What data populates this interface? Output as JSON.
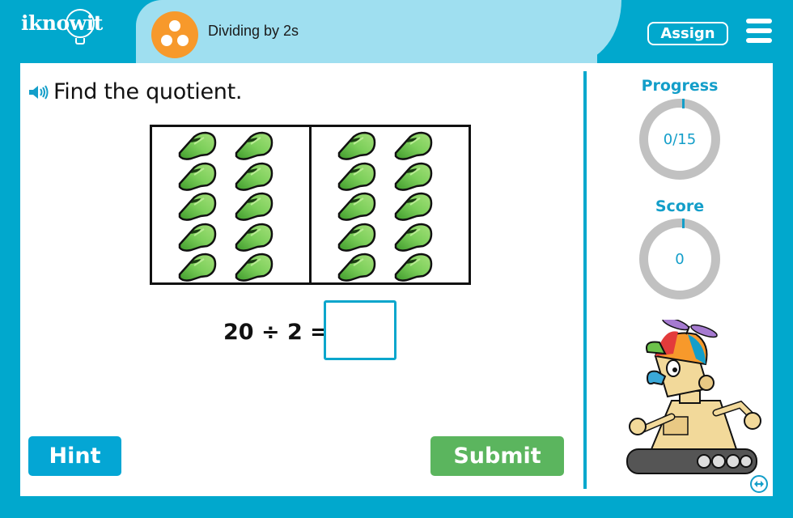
{
  "header": {
    "logo_text": "iknowit",
    "topic_icon": "three-dots-icon",
    "topic_title": "Dividing by 2s",
    "assign_label": "Assign",
    "menu_icon": "hamburger-menu-icon"
  },
  "question": {
    "speaker_icon": "speaker-icon",
    "prompt": "Find the quotient.",
    "groups": [
      {
        "item": "whistle",
        "count": 10
      },
      {
        "item": "whistle",
        "count": 10
      }
    ],
    "equation": "20 ÷ 2 =",
    "answer_value": "",
    "answer_placeholder": ""
  },
  "buttons": {
    "hint_label": "Hint",
    "submit_label": "Submit"
  },
  "sidebar": {
    "progress_label": "Progress",
    "progress_value": "0/15",
    "progress_fraction": 0,
    "score_label": "Score",
    "score_value": "0",
    "score_fraction": 0,
    "mascot": "robot-mascot",
    "expand_icon": "expand-arrows-icon"
  },
  "colors": {
    "brand_blue": "#01a8cd",
    "tab_light_blue": "#9fdff0",
    "topic_orange": "#f7992b",
    "hint_blue": "#04a6d4",
    "submit_green": "#5bb55e",
    "ring_gray": "#c1c1c1",
    "whistle_green": "#6cc24a"
  }
}
